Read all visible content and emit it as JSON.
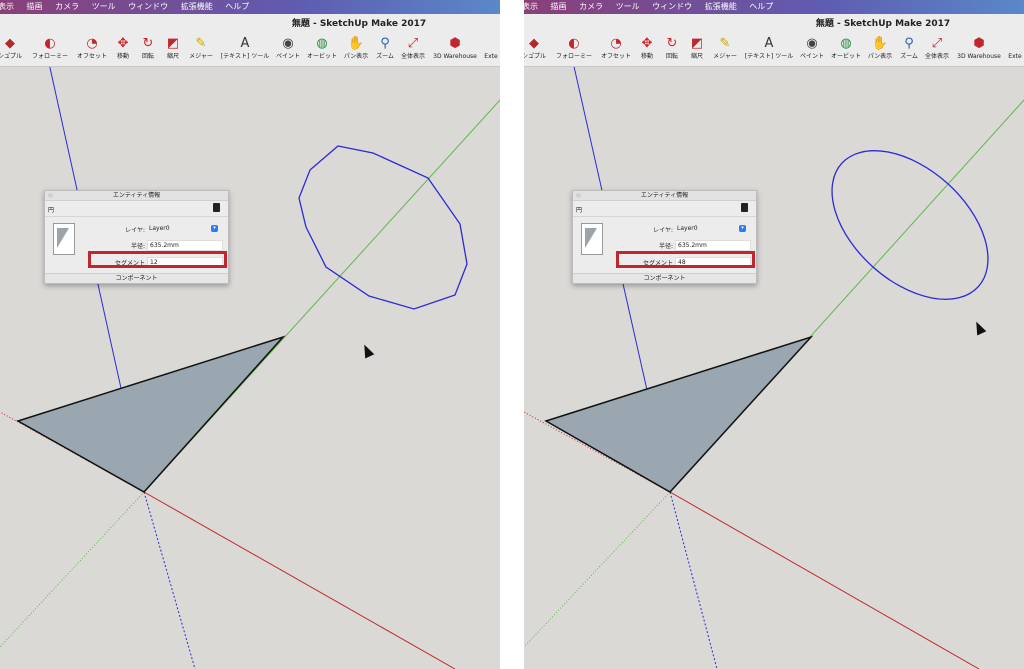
{
  "menu": [
    "表示",
    "描画",
    "カメラ",
    "ツール",
    "ウィンドウ",
    "拡張機能",
    "ヘルプ"
  ],
  "window_title": "無題 - SketchUp Make 2017",
  "tools": [
    {
      "label": "シュ゚プル",
      "icon": "sandbox-icon",
      "glyph": "◆",
      "color": "#b02a2a"
    },
    {
      "label": "フォローミー",
      "icon": "follow-me-icon",
      "glyph": "◐",
      "color": "#c0272d"
    },
    {
      "label": "オフセット",
      "icon": "offset-icon",
      "glyph": "◔",
      "color": "#c0272d"
    },
    {
      "label": "移動",
      "icon": "move-icon",
      "glyph": "✥",
      "color": "#d0232a"
    },
    {
      "label": "回転",
      "icon": "rotate-icon",
      "glyph": "↻",
      "color": "#d0232a"
    },
    {
      "label": "縮尺",
      "icon": "scale-icon",
      "glyph": "◩",
      "color": "#c0272d"
    },
    {
      "label": "メジャー",
      "icon": "tape-measure-icon",
      "glyph": "✎",
      "color": "#c9a600"
    },
    {
      "label": "[テキスト] ツール",
      "icon": "text-icon",
      "glyph": "A",
      "color": "#333333"
    },
    {
      "label": "ペイント",
      "icon": "paint-bucket-icon",
      "glyph": "◉",
      "color": "#444444"
    },
    {
      "label": "オービット",
      "icon": "orbit-icon",
      "glyph": "◍",
      "color": "#2a8a3a"
    },
    {
      "label": "パン表示",
      "icon": "pan-icon",
      "glyph": "✋",
      "color": "#b58a4a"
    },
    {
      "label": "ズーム",
      "icon": "zoom-icon",
      "glyph": "⚲",
      "color": "#2a5fb0"
    },
    {
      "label": "全体表示",
      "icon": "zoom-extents-icon",
      "glyph": "⤢",
      "color": "#d0232a"
    },
    {
      "label": "3D Warehouse",
      "icon": "3d-warehouse-icon",
      "glyph": "⬢",
      "color": "#c0272d"
    },
    {
      "label": "Exte",
      "icon": "extension-icon",
      "glyph": "",
      "color": "#333333"
    }
  ],
  "entity_info": {
    "title": "エンティティ情報",
    "type": "円",
    "layer_label": "レイヤ:",
    "layer_value": "Layer0",
    "radius_label": "半径:",
    "radius_value": "635.2mm",
    "segments_label": "セグメント",
    "footer": "コンポーネント"
  },
  "left": {
    "segments_value": "12"
  },
  "right": {
    "segments_value": "48"
  },
  "colors": {
    "highlight": "#c0272d",
    "circle": "#2b2bd6",
    "face": "#9aa7b1",
    "axis_red": "#c0272d",
    "axis_green": "#5fb84a",
    "axis_blue": "#2b2bd6",
    "canvas": "#dad9d6"
  }
}
